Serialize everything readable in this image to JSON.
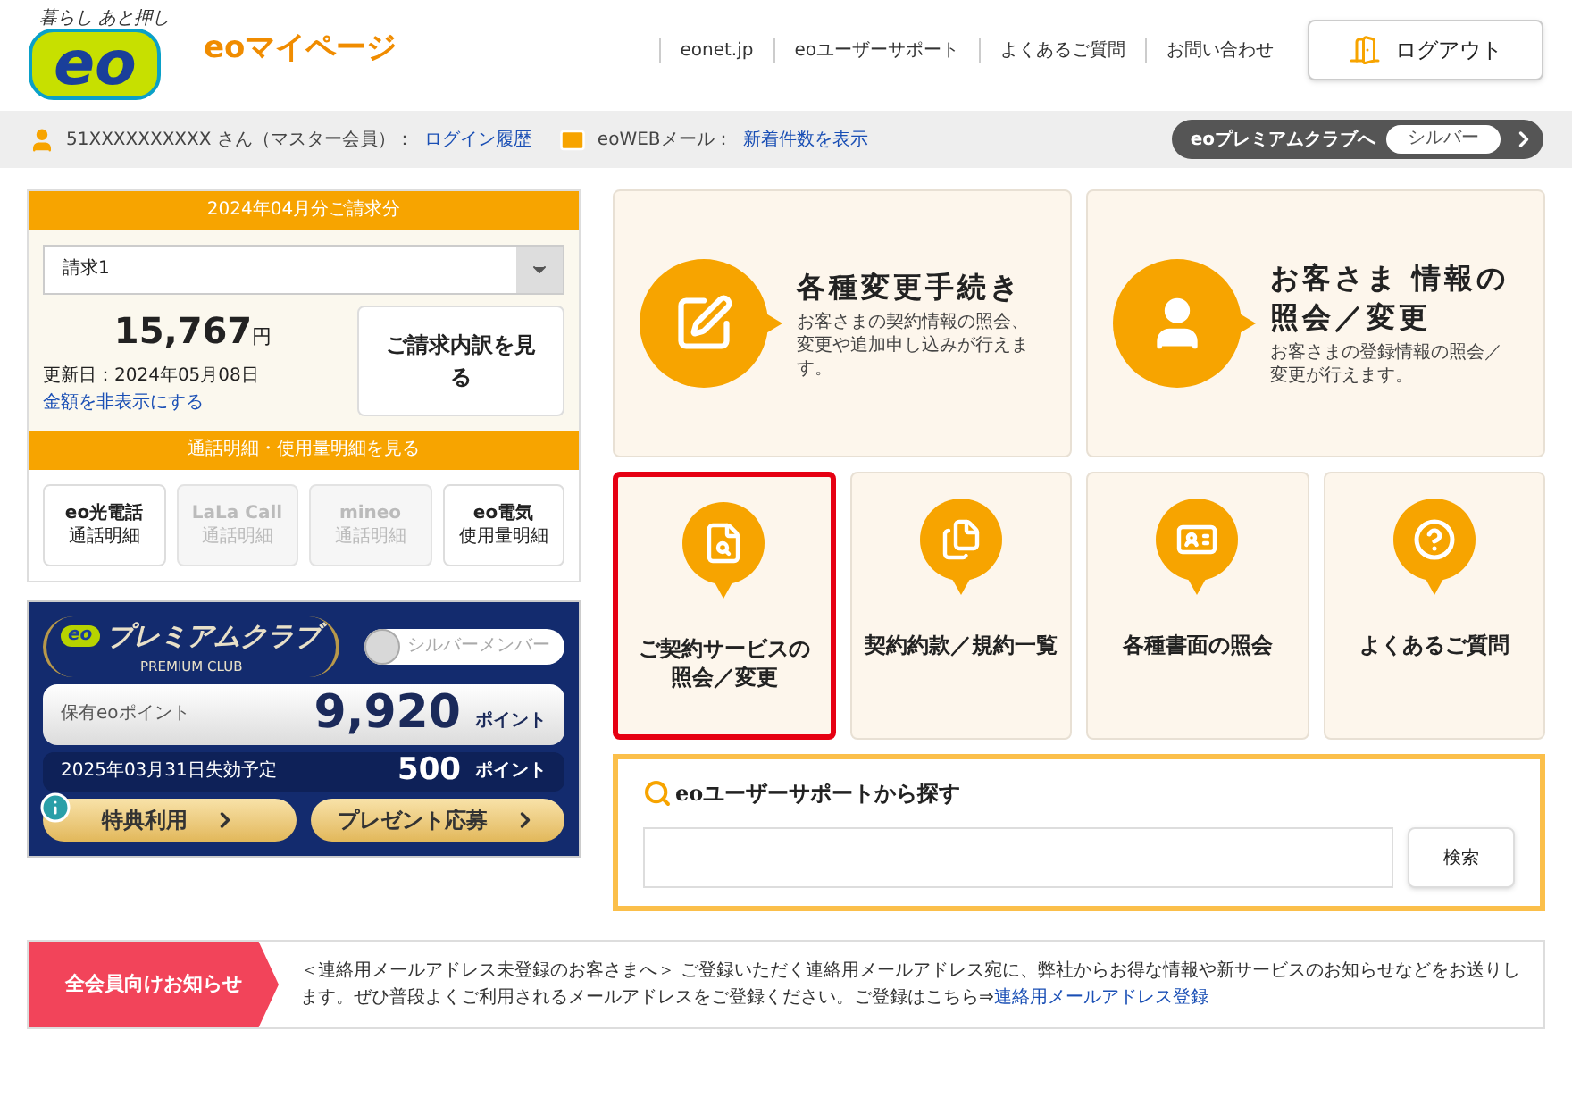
{
  "header": {
    "logo_tagline": "暮らし あと押し",
    "logo": "eo",
    "site_title": "eoマイページ",
    "nav_links": [
      "eonet.jp",
      "eoユーザーサポート",
      "よくあるご質問",
      "お問い合わせ"
    ],
    "logout_button": "ログアウト"
  },
  "user_bar": {
    "user": "51XXXXXXXXXX さん（マスター会員）：",
    "login_history_link": "ログイン履歴",
    "mail_label": "eoWEBメール：",
    "mail_link": "新着件数を表示",
    "premium_button": "eoプレミアムクラブへ",
    "rank_badge": "シルバー"
  },
  "billing": {
    "title": "2024年04月分ご請求分",
    "select_value": "請求1",
    "amount": "15,767",
    "currency": "円",
    "updated": "更新日：2024年05月08日",
    "hide_link": "金額を非表示にする",
    "detail_button": "ご請求内訳を見る",
    "usage_title": "通話明細・使用量明細を見る",
    "usage_buttons": [
      {
        "name": "eo光電話",
        "sub": "通話明細",
        "disabled": false
      },
      {
        "name": "LaLa Call",
        "sub": "通話明細",
        "disabled": true
      },
      {
        "name": "mineo",
        "sub": "通話明細",
        "disabled": true
      },
      {
        "name": "eo電気",
        "sub": "使用量明細",
        "disabled": false
      }
    ]
  },
  "premium": {
    "logo": "eo",
    "title": "プレミアムクラブ",
    "subtitle": "PREMIUM CLUB",
    "member_badge": "シルバーメンバー",
    "points_label": "保有eoポイント",
    "points": "9,920",
    "points_unit": "ポイント",
    "expiry_label": "2025年03月31日失効予定",
    "expiry_points": "500",
    "expiry_unit": "ポイント",
    "buttons": [
      "特典利用",
      "プレゼント応募"
    ]
  },
  "tiles_large": [
    {
      "kind": "form",
      "title": "各種変更手続き",
      "description": "お客さまの契約情報の照会、変更や追加申し込みが行えます。"
    },
    {
      "kind": "person",
      "title": "お客さま 情報の照会／変更",
      "description": "お客さまの登録情報の照会／変更が行えます。"
    }
  ],
  "tiles_small": [
    {
      "kind": "search",
      "label": "ご契約サービスの照会／変更",
      "highlighted": true
    },
    {
      "kind": "documents",
      "label": "契約約款／規約一覧",
      "highlighted": false
    },
    {
      "kind": "card",
      "label": "各種書面の照会",
      "highlighted": false
    },
    {
      "kind": "question",
      "label": "よくあるご質問",
      "highlighted": false
    }
  ],
  "support_search": {
    "title": "eoユーザーサポートから探す",
    "button": "検索"
  },
  "notice": {
    "label": "全会員向けお知らせ",
    "text": "＜連絡用メールアドレス未登録のお客さまへ＞ ご登録いただく連絡用メールアドレス宛に、弊社からお得な情報や新サービスのお知らせなどをお送りします。ぜひ普段よくご利用されるメールアドレスをご登録ください。ご登録はこちら⇒",
    "link": "連絡用メールアドレス登録"
  }
}
